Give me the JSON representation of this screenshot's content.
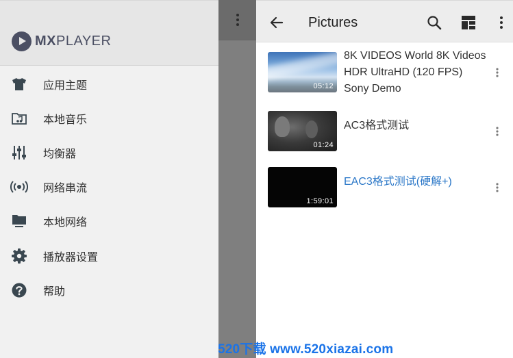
{
  "drawer": {
    "logo_bold": "MX",
    "logo_rest": "PLAYER",
    "items": [
      {
        "label": "应用主题",
        "icon": "shirt-icon"
      },
      {
        "label": "本地音乐",
        "icon": "music-folder-icon"
      },
      {
        "label": "均衡器",
        "icon": "equalizer-icon"
      },
      {
        "label": "网络串流",
        "icon": "stream-icon"
      },
      {
        "label": "本地网络",
        "icon": "local-network-icon"
      },
      {
        "label": "播放器设置",
        "icon": "gear-icon"
      },
      {
        "label": "帮助",
        "icon": "help-icon"
      }
    ]
  },
  "toolbar": {
    "title": "Pictures",
    "icons": [
      "back-arrow-icon",
      "search-icon",
      "layout-icon",
      "more-vert-icon"
    ]
  },
  "videos": [
    {
      "title": "8K VIDEOS   World 8K Videos HDR UltraHD  (120 FPS)   Sony Demo",
      "duration": "05:12",
      "thumb": "sky"
    },
    {
      "title": "AC3格式测试",
      "duration": "01:24",
      "thumb": "crowd"
    },
    {
      "title": "EAC3格式测试(硬解+)",
      "duration": "1:59:01",
      "thumb": "black",
      "highlighted": true
    }
  ],
  "watermark": "520下载 www.520xiazai.com",
  "colors": {
    "accent": "#2c78c8",
    "icon": "#3a4750",
    "drawer_bg": "#f1f1f1",
    "toolbar_bg": "#ededed",
    "watermark": "#1a73e8"
  }
}
